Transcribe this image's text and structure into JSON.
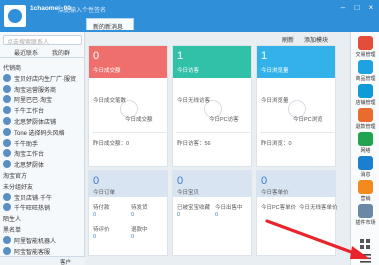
{
  "header": {
    "username": "1chaomei_00",
    "signature": "点此输入个性签名",
    "tab_new_message": "新的新消息"
  },
  "sidebar": {
    "search_placeholder": "点击搜索联系人",
    "tabs": [
      "最近联系",
      "我的群"
    ],
    "rows": [
      {
        "kind": "group",
        "label": "代销商"
      },
      {
        "kind": "contact",
        "label": "宝贝好店内生厂广·服贸"
      },
      {
        "kind": "contact",
        "label": "淘宝运营服务商"
      },
      {
        "kind": "contact",
        "label": "阿里巴巴·淘宝"
      },
      {
        "kind": "contact",
        "label": "千牛工作台"
      },
      {
        "kind": "contact",
        "label": "北思梦厨体店铺"
      },
      {
        "kind": "contact",
        "label": "Tone 选择码头风格"
      },
      {
        "kind": "contact",
        "label": "千牛助手"
      },
      {
        "kind": "contact",
        "label": "淘宝工作台"
      },
      {
        "kind": "contact",
        "label": "北思梦厨体"
      },
      {
        "kind": "group",
        "label": "淘宝官方"
      },
      {
        "kind": "group",
        "label": "未分组好友"
      },
      {
        "kind": "contact",
        "label": "宝贝店铺·千牛"
      },
      {
        "kind": "contact",
        "label": "千牛旺旺热销"
      },
      {
        "kind": "group",
        "label": "陌生人"
      },
      {
        "kind": "group",
        "label": "黑名单"
      },
      {
        "kind": "contact",
        "label": "阿里智能机器人"
      },
      {
        "kind": "contact",
        "label": "阿宝智能客服"
      }
    ],
    "bottom_label": "客户"
  },
  "toolbar": {
    "refresh_label": "刷新",
    "add_label": "添加模块"
  },
  "cards": [
    {
      "color": "#ef6f6c",
      "value": "0",
      "sub": "今日成交额",
      "metrics": [
        "今日成交笔数",
        "今日成交额",
        "昨日成交额：0"
      ]
    },
    {
      "color": "#31c0a8",
      "value": "1",
      "sub": "今日访客",
      "metrics": [
        "今日无线访客",
        "今日PC访客",
        "昨日访客：56"
      ]
    },
    {
      "color": "#32b2e8",
      "value": "1",
      "sub": "今日浏览量",
      "metrics": [
        "今日浏览量",
        "今日PC浏览",
        "昨日浏览：0"
      ]
    }
  ],
  "lower_cards": [
    {
      "value": "0",
      "sub": "今日订单",
      "rows": [
        "待付款",
        "待发货",
        "待评价",
        "退款中"
      ],
      "vals": [
        "0",
        "0",
        "0",
        "0"
      ]
    },
    {
      "value": "0",
      "sub": "今日宝贝",
      "rows": [
        "已被宝宝收藏",
        "今日出售中"
      ],
      "vals": [
        "0",
        "0"
      ]
    },
    {
      "value": "0",
      "sub": "今日客单价",
      "rows": [
        "今日PC客单价",
        "今日无线客单价"
      ],
      "vals": [
        "",
        ""
      ]
    }
  ],
  "rail": [
    {
      "label": "交易管理",
      "color": "#e44d3a"
    },
    {
      "label": "商品管理",
      "color": "#1fa2e1"
    },
    {
      "label": "店铺管理",
      "color": "#0f9bd7"
    },
    {
      "label": "退款管理",
      "color": "#e96b2d"
    },
    {
      "label": "网络",
      "color": "#21a350"
    },
    {
      "label": "消息",
      "color": "#1a7fcf"
    },
    {
      "label": "营销",
      "color": "#f28a1e"
    },
    {
      "label": "插件市场",
      "color": "#6a87a8"
    }
  ]
}
